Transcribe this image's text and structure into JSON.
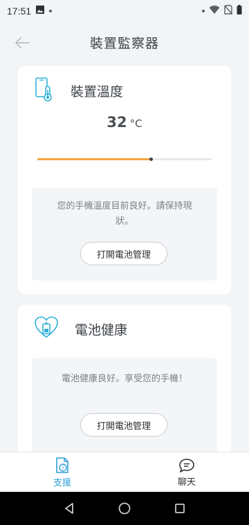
{
  "status_bar": {
    "time": "17:51"
  },
  "header": {
    "title": "裝置監察器"
  },
  "temperature_card": {
    "title": "裝置溫度",
    "temperature_value": "32",
    "temperature_unit": "°C",
    "level_fraction": 0.65,
    "message": "您的手機溫度目前良好。請保持現狀。",
    "button_label": "打開電池管理"
  },
  "battery_card": {
    "title": "電池健康",
    "message": "電池健康良好。享受您的手機！",
    "button_label": "打開電池管理"
  },
  "bottom_nav": {
    "items": [
      {
        "label": "支援",
        "icon": "support-document-icon",
        "active": true
      },
      {
        "label": "聊天",
        "icon": "chat-bubble-icon",
        "active": false
      }
    ]
  },
  "colors": {
    "accent": "#2f9fd6",
    "progress": "#f0a43c",
    "background": "#f2f4f6"
  }
}
